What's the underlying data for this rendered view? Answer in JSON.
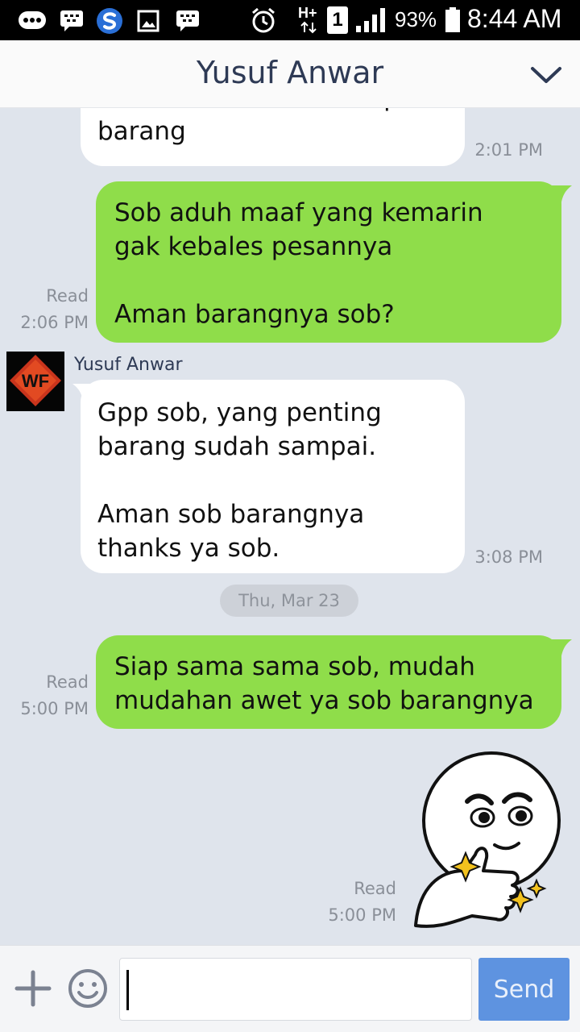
{
  "status_bar": {
    "battery": "93%",
    "time": "8:44 AM",
    "network": "H+",
    "sim": "1",
    "icons": [
      "bbm-icon",
      "messenger-icon",
      "sync-icon",
      "gallery-icon",
      "bbm-icon",
      "alarm-icon",
      "signal-icon",
      "battery-icon"
    ]
  },
  "header": {
    "title": "Yusuf Anwar",
    "chevron_icon": "chevron-down-icon"
  },
  "messages": [
    {
      "direction": "in",
      "text": "Thanks sob sudah sampai\nbarang",
      "time": "2:01 PM"
    },
    {
      "direction": "out",
      "text": "Sob aduh maaf yang kemarin\ngak kebales pesannya\n\nAman barangnya sob?",
      "status": "Read",
      "time": "2:06 PM"
    },
    {
      "direction": "in",
      "sender": "Yusuf Anwar",
      "text": "Gpp sob, yang penting\nbarang sudah sampai.\n\nAman sob barangnya\nthanks ya sob.",
      "time": "3:08 PM"
    },
    {
      "direction": "out",
      "text": "Siap sama sama sob, mudah\nmudahan awet ya sob barangnya",
      "status": "Read",
      "time": "5:00 PM"
    },
    {
      "direction": "out",
      "type": "sticker",
      "sticker": "thumbs-up-face-sticker",
      "status": "Read",
      "time": "5:00 PM"
    }
  ],
  "date_separator": "Thu, Mar 23",
  "avatar_text": "WF",
  "input": {
    "value": "",
    "placeholder": "",
    "send_label": "Send"
  },
  "colors": {
    "outgoing_bubble": "#8fdd4a",
    "incoming_bubble": "#ffffff",
    "chat_background": "#dfe4ec",
    "send_button": "#5e93e0",
    "title": "#2e3a55"
  }
}
